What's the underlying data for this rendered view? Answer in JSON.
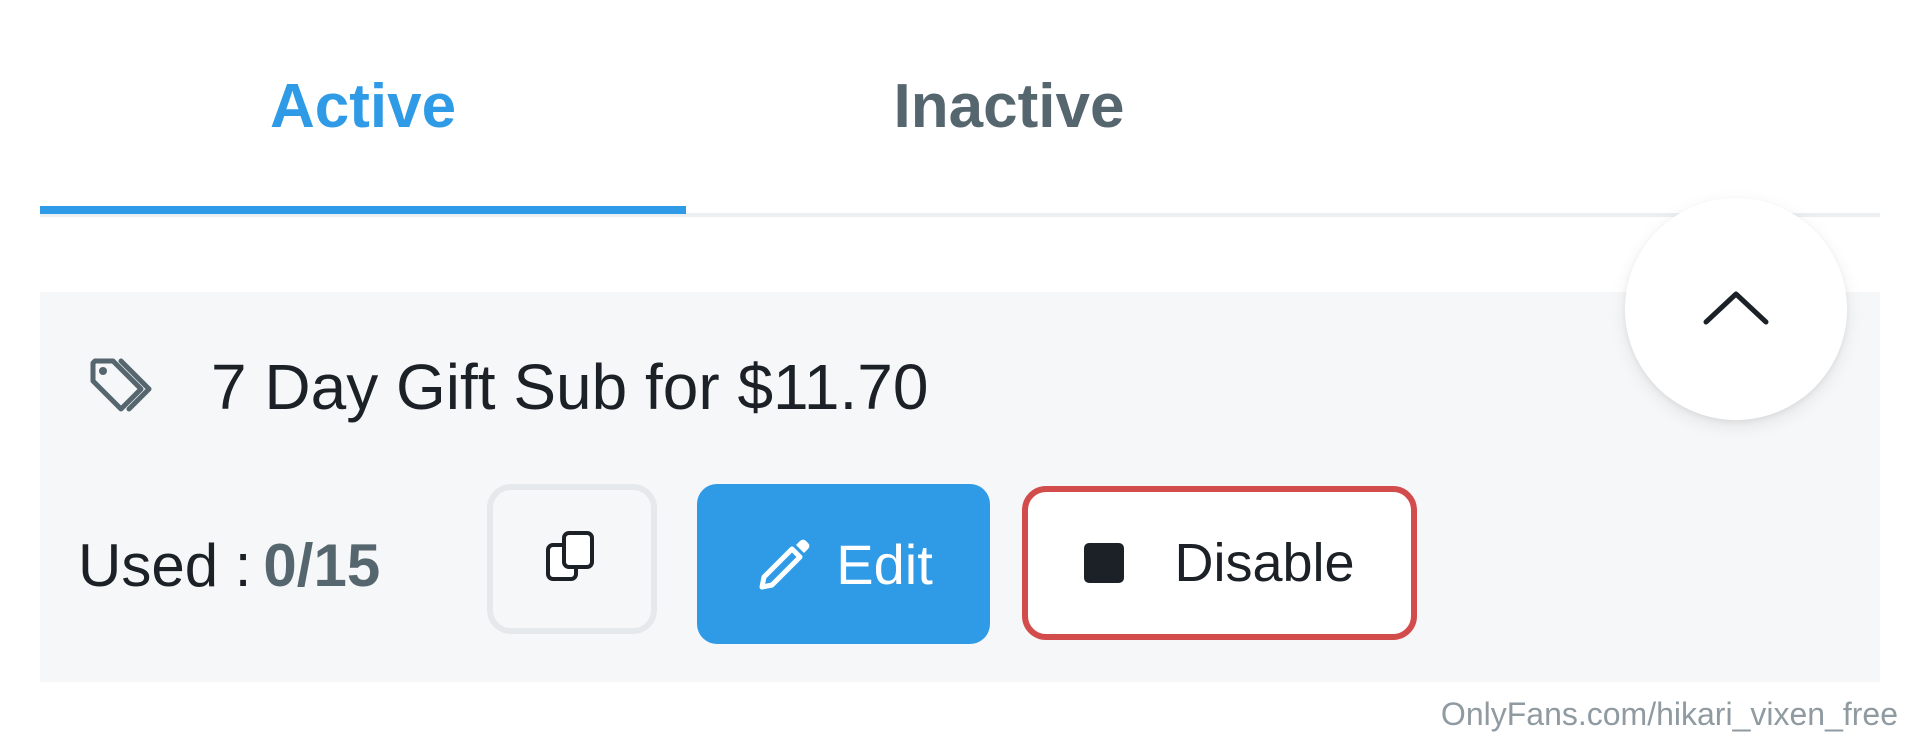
{
  "tabs": {
    "active_label": "Active",
    "inactive_label": "Inactive"
  },
  "card": {
    "title": "7 Day Gift Sub for $11.70",
    "used_label": "Used :",
    "used_value": "0/15",
    "edit_label": "Edit",
    "disable_label": "Disable"
  },
  "icons": {
    "tag": "tag-icon",
    "copy": "copy-icon",
    "edit": "pencil-icon",
    "disable": "stop-icon",
    "scroll_top": "chevron-up-icon"
  },
  "colors": {
    "accent": "#2f9be6",
    "tab_inactive": "#56666f",
    "disable_border": "#d24c4c",
    "card_background": "#f6f7f8"
  },
  "watermark": "OnlyFans.com/hikari_vixen_free"
}
